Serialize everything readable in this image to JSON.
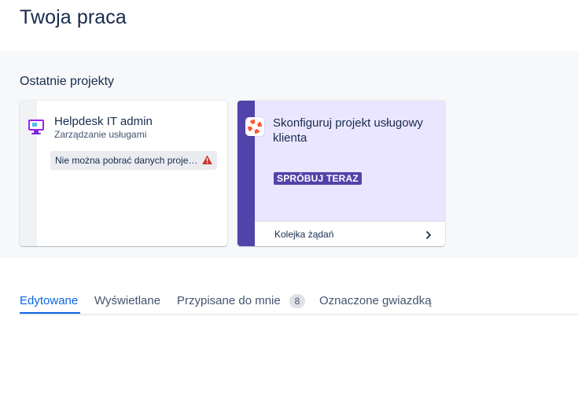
{
  "page": {
    "title": "Twoja praca"
  },
  "recent_projects": {
    "heading": "Ostatnie projekty",
    "cards": [
      {
        "name": "Helpdesk IT admin",
        "type": "Zarządzanie usługami",
        "error": "Nie można pobrać danych proje…",
        "icon": "monitor-icon",
        "accent": "#a020f0"
      }
    ],
    "promo": {
      "title": "Skonfiguruj projekt usługowy klienta",
      "badge": "SPRÓBUJ TERAZ",
      "queue_label": "Kolejka żądań",
      "icon": "lifebuoy-icon",
      "accent": "#5243aa"
    }
  },
  "tabs": {
    "items": [
      {
        "label": "Edytowane",
        "active": true
      },
      {
        "label": "Wyświetlane",
        "active": false
      },
      {
        "label": "Przypisane do mnie",
        "active": false,
        "count": "8"
      },
      {
        "label": "Oznaczone gwiazdką",
        "active": false
      }
    ]
  },
  "colors": {
    "primary": "#0c66e4",
    "text": "#172b4d",
    "subtle": "#44546f",
    "warning": "#c9372c"
  }
}
